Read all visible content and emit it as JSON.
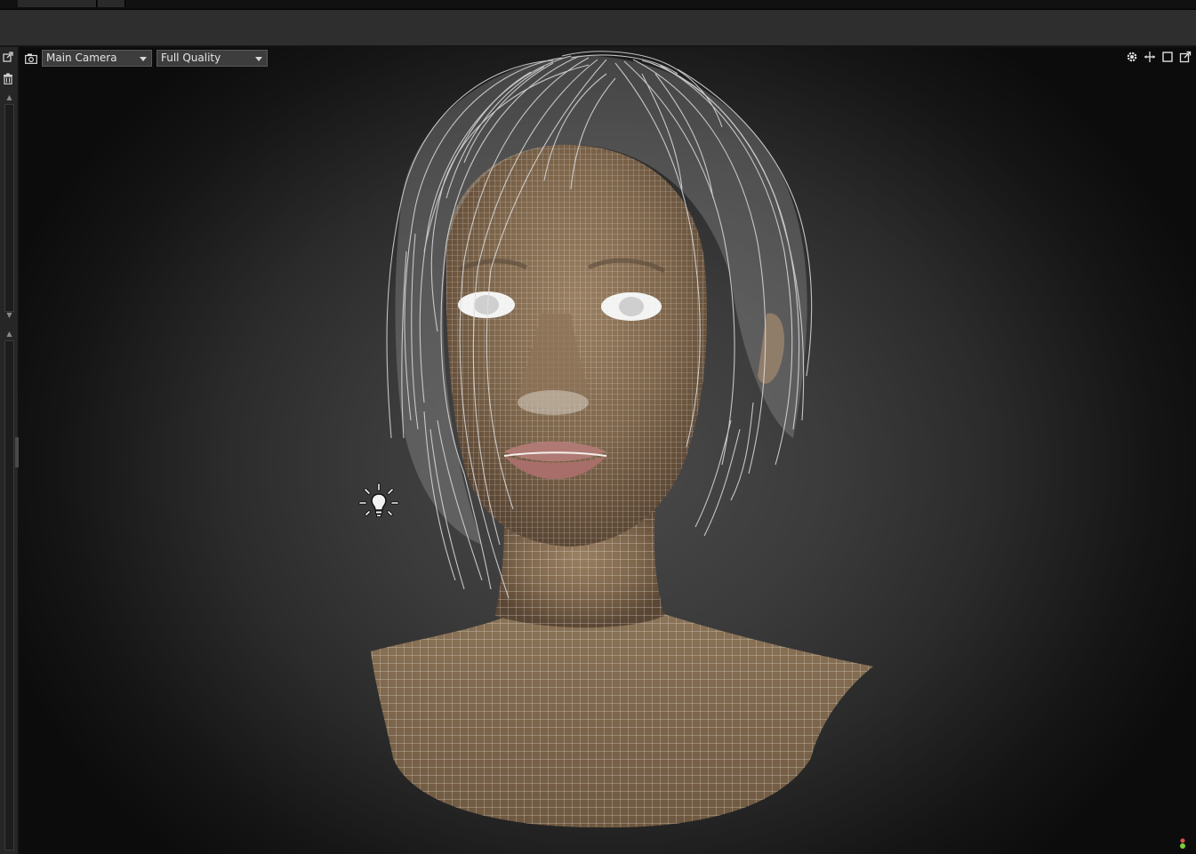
{
  "viewport": {
    "camera_select": {
      "value": "Main Camera"
    },
    "quality_select": {
      "value": "Full Quality"
    },
    "toolbar_icons": [
      "gear-icon",
      "move-axis-icon",
      "maximize-icon",
      "popout-icon"
    ],
    "scene_icons": [
      "camera-icon",
      "light-bulb-icon"
    ],
    "status_colors": {
      "green": "#7ccf3c",
      "red": "#d9534f"
    }
  },
  "left_panel": {
    "icons": [
      "popout-icon",
      "trash-icon"
    ]
  },
  "colors": {
    "background_center": "#4a4a4a",
    "skin": "#8a7257",
    "wire": "#e9e4dc",
    "hair": "#dcdcdc"
  }
}
